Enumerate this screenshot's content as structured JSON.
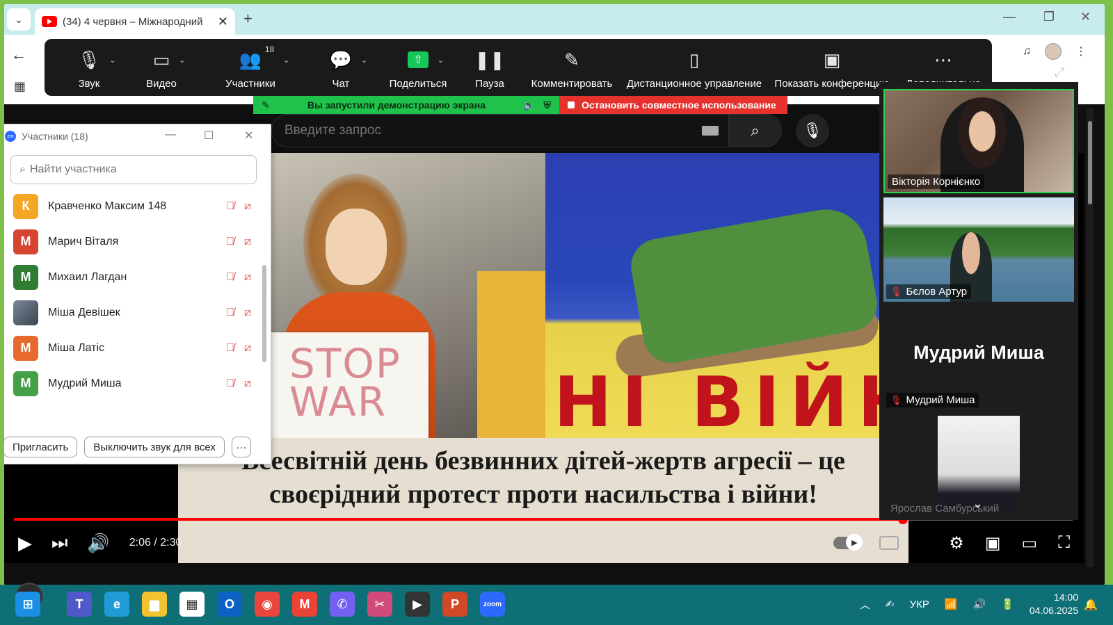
{
  "browser": {
    "tab_title": "(34) 4 червня – Міжнародний",
    "tab_close": "✕",
    "new_tab": "+",
    "win_min": "—",
    "win_restore": "❐",
    "win_close": "✕"
  },
  "zoom_toolbar": {
    "items": [
      {
        "label": "Звук",
        "icon": "microphone-icon"
      },
      {
        "label": "Видео",
        "icon": "video-camera-icon"
      },
      {
        "label": "Участники",
        "icon": "participants-icon",
        "count": "18"
      },
      {
        "label": "Чат",
        "icon": "chat-icon"
      },
      {
        "label": "Поделиться",
        "icon": "share-screen-icon"
      },
      {
        "label": "Пауза",
        "icon": "pause-icon"
      },
      {
        "label": "Комментировать",
        "icon": "pencil-icon"
      },
      {
        "label": "Дистанционное управление",
        "icon": "mouse-icon"
      },
      {
        "label": "Показать конференцию",
        "icon": "show-meeting-icon"
      },
      {
        "label": "Дополнительно",
        "icon": "more-icon"
      }
    ]
  },
  "share_banner": {
    "message": "Вы запустили демонстрацию экрана",
    "stop_label": "Остановить совместное использование",
    "green": "#1fc24a",
    "red": "#e5322d"
  },
  "youtube": {
    "search_placeholder": "Введите запрос",
    "video": {
      "sign_text_1": "STOP",
      "sign_text_2": "WAR",
      "drawing_text": "НІ ВІЙНІ",
      "caption_line1": "Всесвітній день безвинних дітей-жертв агресії – це",
      "caption_line2": "своєрідний протест проти насильства і війни!",
      "time": "2:06 / 2:30",
      "progress": 0.84
    }
  },
  "participants_panel": {
    "title": "Участники (18)",
    "search_placeholder": "Найти участника",
    "participants": [
      {
        "initial": "К",
        "name": "Кравченко Максим 148",
        "color": "#f5a623"
      },
      {
        "initial": "М",
        "name": "Марич Віталя",
        "color": "#d64532"
      },
      {
        "initial": "М",
        "name": "Михаил Лагдан",
        "color": "#2e7d32"
      },
      {
        "initial": "",
        "name": "Міша Девішек",
        "color": "#5b6b7a"
      },
      {
        "initial": "М",
        "name": "Міша Латіс",
        "color": "#e8692d"
      },
      {
        "initial": "М",
        "name": "Мудрий Миша",
        "color": "#43a047"
      }
    ],
    "invite_label": "Пригласить",
    "mute_all_label": "Выключить звук для всех",
    "more_label": "···"
  },
  "gallery": {
    "tiles": [
      {
        "name": "Вікторія Корнієнко"
      },
      {
        "name": "Бєлов Артур"
      },
      {
        "name": "Мудрий Миша",
        "big_name": "Мудрий Миша"
      },
      {
        "name": "Ярослав Самбурський"
      }
    ]
  },
  "taskbar": {
    "apps": [
      {
        "name": "windows-start-icon",
        "color": "#1a8fe3",
        "glyph": "⊞"
      },
      {
        "name": "teams-icon",
        "color": "#5059c9",
        "glyph": "T"
      },
      {
        "name": "edge-icon",
        "color": "#1f9cd8",
        "glyph": "e"
      },
      {
        "name": "file-explorer-icon",
        "color": "#f2c230",
        "glyph": "▆"
      },
      {
        "name": "store-icon",
        "color": "#ffffff",
        "glyph": "▦"
      },
      {
        "name": "outlook-icon",
        "color": "#0f62c5",
        "glyph": "O"
      },
      {
        "name": "chrome-icon",
        "color": "#e8453c",
        "glyph": "◉"
      },
      {
        "name": "gmail-icon",
        "color": "#ea4335",
        "glyph": "M"
      },
      {
        "name": "viber-icon",
        "color": "#7360f2",
        "glyph": "✆"
      },
      {
        "name": "snipping-tool-icon",
        "color": "#d04a7a",
        "glyph": "✂"
      },
      {
        "name": "media-player-icon",
        "color": "#333333",
        "glyph": "▶"
      },
      {
        "name": "powerpoint-icon",
        "color": "#d24726",
        "glyph": "P"
      },
      {
        "name": "zoom-icon",
        "color": "#2d68ff",
        "glyph": "zoom"
      }
    ],
    "lang": "УКР",
    "time": "14:00",
    "date": "04.06.2025"
  }
}
